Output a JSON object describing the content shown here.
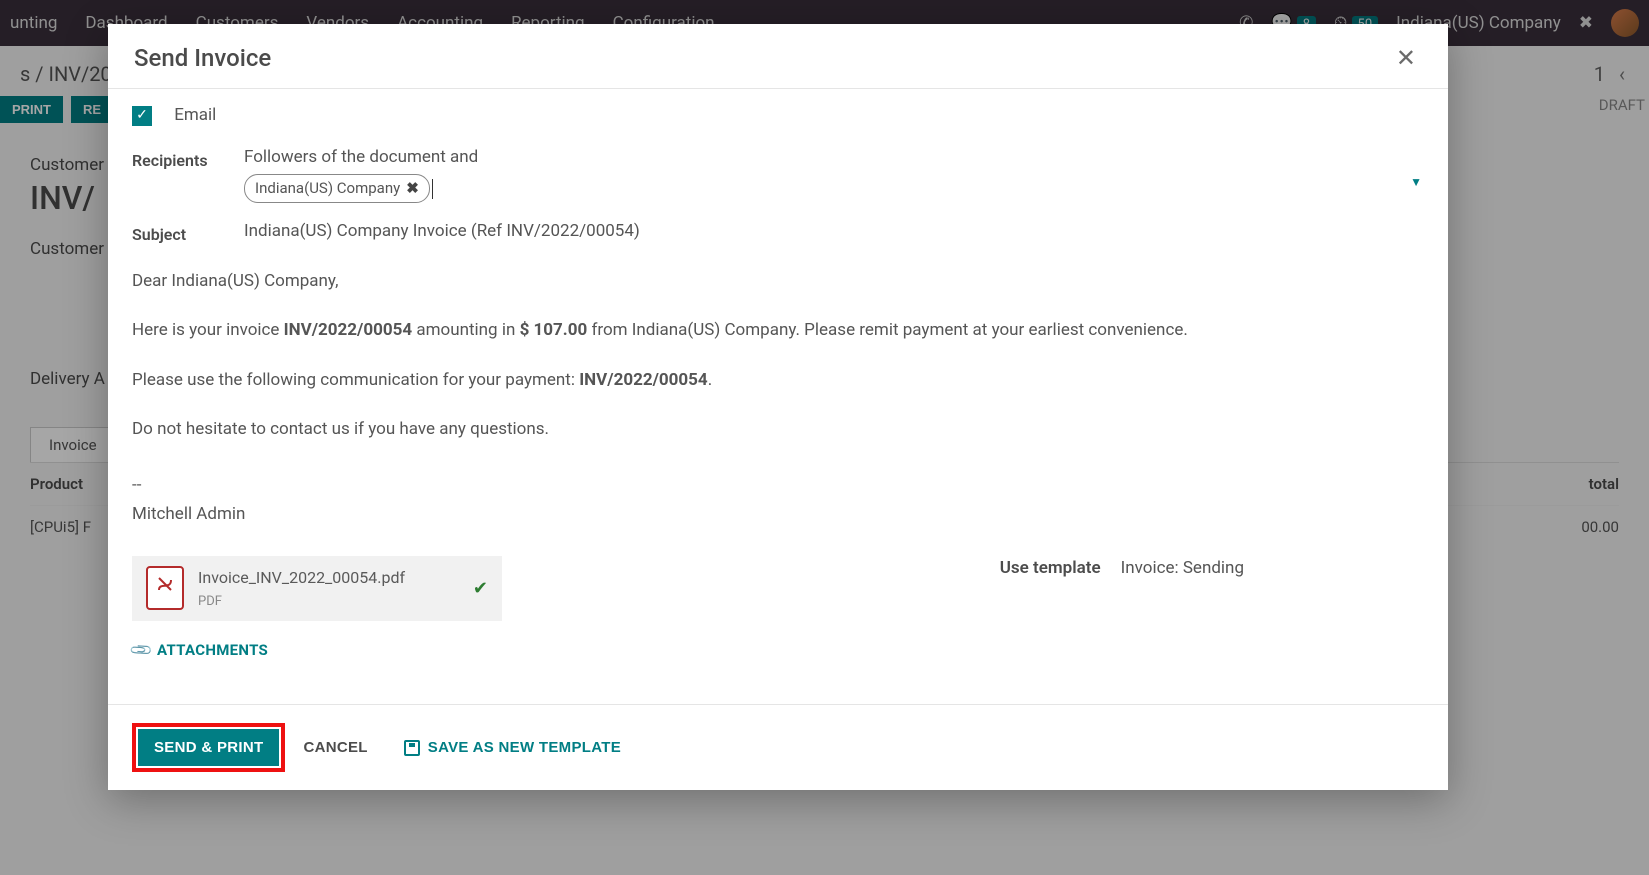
{
  "topbar": {
    "app": "unting",
    "menu": [
      "Dashboard",
      "Customers",
      "Vendors",
      "Accounting",
      "Reporting",
      "Configuration"
    ],
    "msg_badge": "8",
    "clock_badge": "50",
    "company": "Indiana(US) Company"
  },
  "breadcrumb": {
    "path_prefix": "s / ",
    "current": "INV/20",
    "pager_count": "1",
    "status_right": "DRAFT"
  },
  "actions": {
    "print": "PRINT",
    "re": "RE"
  },
  "page": {
    "customer_label": "Customer",
    "title": "INV/",
    "customer2_label": "Customer",
    "delivery_label": "Delivery A",
    "tab": "Invoice",
    "col_product": "Product",
    "col_total": "total",
    "row_product": "[CPUi5] F",
    "row_total": "00.00"
  },
  "modal": {
    "title": "Send Invoice",
    "email_label": "Email",
    "recipients_label": "Recipients",
    "recipients_prefix": "Followers of the document and",
    "recipient_tag": "Indiana(US) Company",
    "subject_label": "Subject",
    "subject_value": "Indiana(US) Company Invoice (Ref INV/2022/00054)",
    "body": {
      "greeting": "Dear Indiana(US) Company,",
      "line1_a": "Here is your invoice ",
      "line1_inv": "INV/2022/00054",
      "line1_b": " amounting in ",
      "line1_amt": "$ 107.00",
      "line1_c": " from Indiana(US) Company. Please remit payment at your earliest convenience.",
      "line2_a": "Please use the following communication for your payment: ",
      "line2_ref": "INV/2022/00054",
      "line2_b": ".",
      "line3": "Do not hesitate to contact us if you have any questions.",
      "sig_dash": "--",
      "sig_name": "Mitchell Admin"
    },
    "attachment": {
      "filename": "Invoice_INV_2022_00054.pdf",
      "filetype": "PDF"
    },
    "template_label": "Use template",
    "template_value": "Invoice: Sending",
    "attachments_btn": "ATTACHMENTS",
    "footer": {
      "send": "SEND & PRINT",
      "cancel": "CANCEL",
      "save_template": "SAVE AS NEW TEMPLATE"
    }
  }
}
